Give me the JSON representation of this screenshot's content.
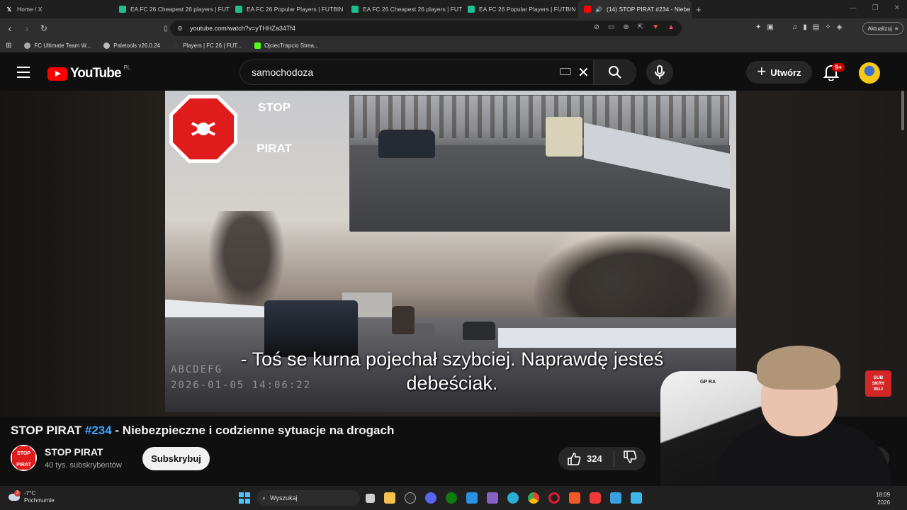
{
  "browser": {
    "tabs": [
      {
        "title": "Home / X",
        "icon": "x-logo-icon",
        "active": false
      },
      {
        "title": "EA FC 26 Cheapest 26 players | FUTB",
        "icon": "futbin-icon",
        "active": false
      },
      {
        "title": "EA FC 26 Popular Players | FUTBIN",
        "icon": "futbin-icon",
        "active": false
      },
      {
        "title": "EA FC 26 Cheapest 26 players | FUTB",
        "icon": "futbin-icon",
        "active": false
      },
      {
        "title": "EA FC 26 Popular Players | FUTBIN",
        "icon": "futbin-icon",
        "active": false
      },
      {
        "title": "(14) STOP PIRAT #234 - Niebe",
        "icon": "youtube-icon",
        "active": true
      }
    ],
    "url": "youtube.com/watch?v=yTHHZa34Tf4",
    "update_label": "Aktualizuj",
    "bookmarks": [
      {
        "label": "FC Ultimate Team W..."
      },
      {
        "label": "Paletools v26.0.24"
      },
      {
        "label": "Players | FC 26 | FUT..."
      },
      {
        "label": "OjciecTrapcio Strea..."
      }
    ]
  },
  "youtube": {
    "logo_text": "YouTube",
    "country_code": "PL",
    "search_value": "samochodoza",
    "create_label": "Utwórz",
    "notifications_badge": "9+"
  },
  "video": {
    "stop_sign_line1": "STOP",
    "stop_sign_line2": "PIRAT",
    "dashcam_label": "ABCDEFG",
    "dashcam_timestamp": "2026-01-05 14:06:22",
    "subtitle_line1": "- Toś se kurna pojechał szybciej. Naprawdę jesteś",
    "subtitle_line2": "debeściak.",
    "sticker_line1": "SUB",
    "sticker_line2": "SKRY",
    "sticker_line3": "BUJ",
    "chair_logo": "GP RA"
  },
  "info": {
    "title_prefix": "STOP PIRAT ",
    "title_tag": "#234",
    "title_rest": " - Niebezpieczne i codzienne sytuacje na drogach",
    "channel_name": "STOP PIRAT",
    "subscribers": "40 tys. subskrybentów",
    "subscribe_label": "Subskrybuj",
    "likes": "324",
    "partial_button": "o"
  },
  "taskbar": {
    "temperature": "-7°C",
    "weather": "Pochmurnie",
    "weather_badge": "3",
    "search_label": "Wyszukaj",
    "time": "18:09",
    "date": "2026"
  },
  "colors": {
    "youtube_red": "#ff0000",
    "link_blue": "#3ea6ff",
    "background": "#0f0f0f"
  }
}
